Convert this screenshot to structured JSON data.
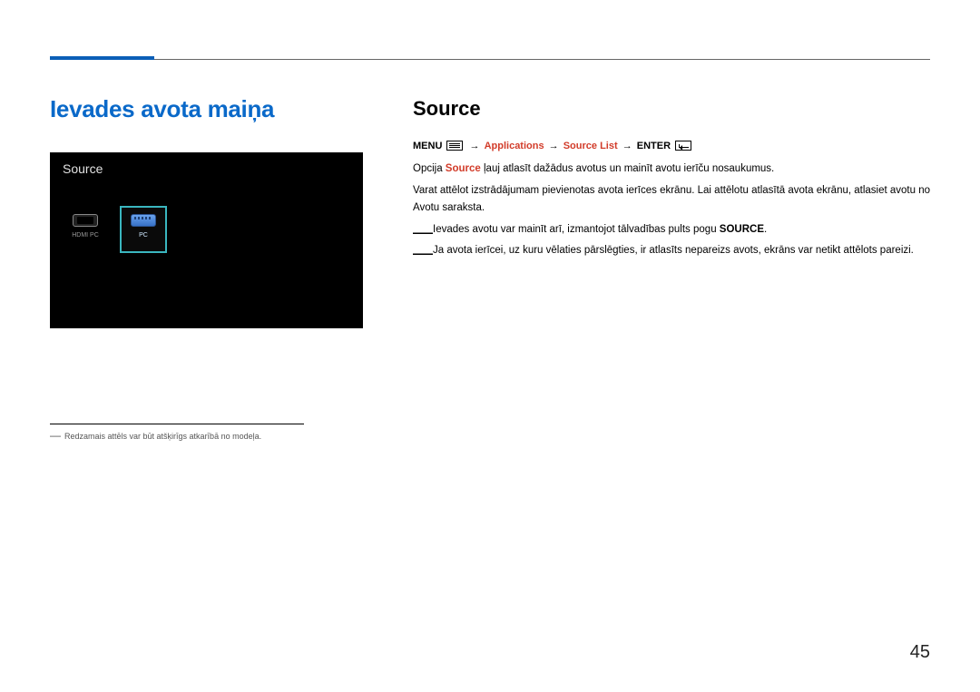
{
  "left": {
    "heading": "Ievades avota maiņa",
    "screenshot": {
      "title": "Source",
      "tiles": [
        {
          "label": "HDMI PC"
        },
        {
          "label": "PC"
        }
      ]
    },
    "footnote": "Redzamais attēls var būt atšķirīgs atkarībā no modeļa."
  },
  "right": {
    "heading": "Source",
    "nav": {
      "menu": "MENU",
      "applications": "Applications",
      "source_list": "Source List",
      "enter": "ENTER",
      "arrow": "→"
    },
    "p1_a": "Opcija ",
    "p1_b": "Source",
    "p1_c": " ļauj atlasīt dažādus avotus un mainīt avotu ierīču nosaukumus.",
    "p2": "Varat attēlot izstrādājumam pievienotas avota ierīces ekrānu. Lai attēlotu atlasītā avota ekrānu, atlasiet avotu no Avotu saraksta.",
    "note1_a": "Ievades avotu var mainīt arī, izmantojot tālvadības pults pogu ",
    "note1_b": "SOURCE",
    "note1_c": ".",
    "note2": "Ja avota ierīcei, uz kuru vēlaties pārslēgties, ir atlasīts nepareizs avots, ekrāns var netikt attēlots pareizi."
  },
  "page_number": "45"
}
